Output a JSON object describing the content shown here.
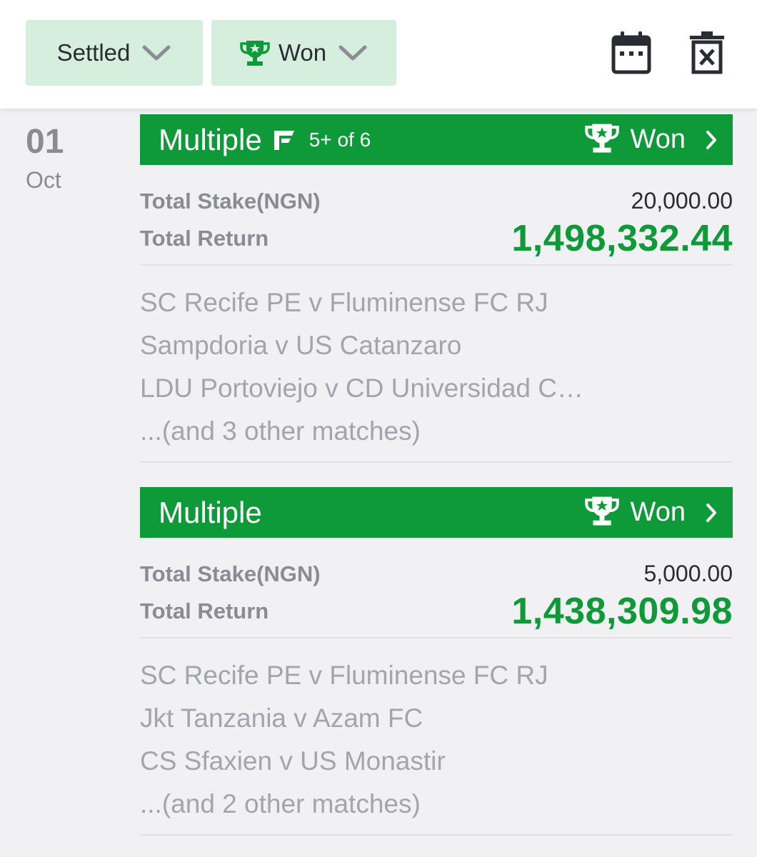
{
  "filters": {
    "status_label": "Settled",
    "outcome_label": "Won"
  },
  "icons": {
    "calendar": "calendar-icon",
    "delete": "delete-icon",
    "trophy": "trophy-icon",
    "chevron": "chevron-down-icon",
    "flex": "flex-icon"
  },
  "colors": {
    "accent_green": "#0e9a38",
    "filter_bg": "#d6eedd",
    "muted_text": "#8a8c93"
  },
  "date": {
    "day": "01",
    "month": "Oct"
  },
  "tickets": [
    {
      "type": "Multiple",
      "flex_rule": "5+ of 6",
      "status": "Won",
      "stake_label": "Total Stake(NGN)",
      "stake": "20,000.00",
      "return_label": "Total Return",
      "return": "1,498,332.44",
      "matches": [
        "SC Recife PE v Fluminense FC RJ",
        "Sampdoria v US Catanzaro",
        "LDU Portoviejo v CD Universidad C…",
        "...(and 3 other matches)"
      ]
    },
    {
      "type": "Multiple",
      "status": "Won",
      "stake_label": "Total Stake(NGN)",
      "stake": "5,000.00",
      "return_label": "Total Return",
      "return": "1,438,309.98",
      "matches": [
        "SC Recife PE v Fluminense FC RJ",
        "Jkt Tanzania v Azam FC",
        "CS Sfaxien v US Monastir",
        "...(and 2 other matches)"
      ]
    }
  ]
}
